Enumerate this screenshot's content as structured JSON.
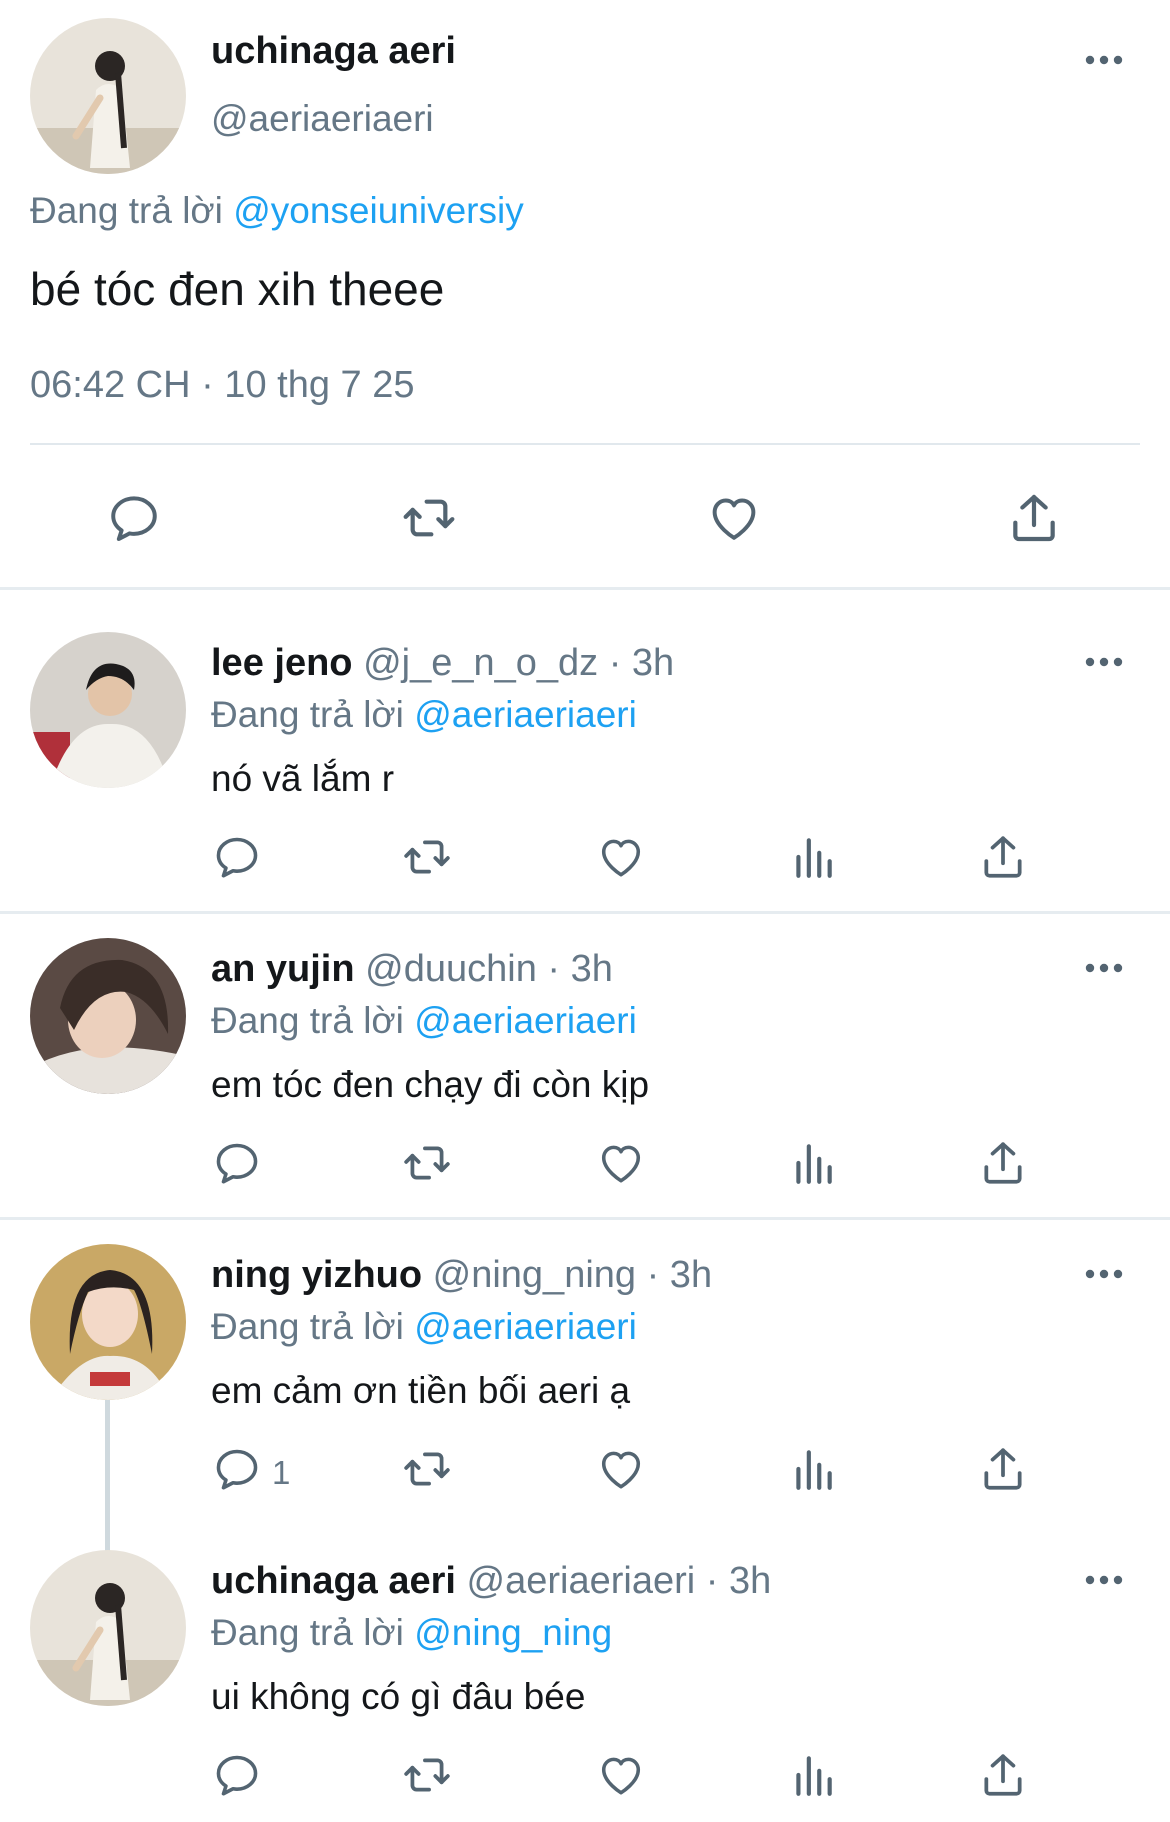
{
  "main_tweet": {
    "name": "uchinaga aeri",
    "handle": "@aeriaeriaeri",
    "replying_prefix": "Đang trả lời",
    "replying_to": "@yonseiuniversiy",
    "text": "bé tóc đen xih theee",
    "timestamp": "06:42 CH · 10 thg 7 25"
  },
  "replies": [
    {
      "name": "lee jeno",
      "meta": "@j_e_n_o_dz · 3h",
      "replying_prefix": "Đang trả lời",
      "replying_to": "@aeriaeriaeri",
      "text": "nó vã lắm r",
      "reply_count": ""
    },
    {
      "name": "an yujin",
      "meta": "@duuchin · 3h",
      "replying_prefix": "Đang trả lời",
      "replying_to": "@aeriaeriaeri",
      "text": "em tóc đen chạy đi còn kịp",
      "reply_count": ""
    },
    {
      "name": "ning yizhuo",
      "meta": "@ning_ning · 3h",
      "replying_prefix": "Đang trả lời",
      "replying_to": "@aeriaeriaeri",
      "text": "em cảm ơn tiền bối aeri ạ",
      "reply_count": "1"
    },
    {
      "name": "uchinaga aeri",
      "meta": "@aeriaeriaeri · 3h",
      "replying_prefix": "Đang trả lời",
      "replying_to": "@ning_ning",
      "text": "ui không có gì đâu bée",
      "reply_count": ""
    }
  ],
  "icons": {
    "reply": "reply-icon",
    "retweet": "retweet-icon",
    "like": "heart-icon",
    "views": "analytics-icon",
    "share": "share-icon",
    "more": "more-icon"
  },
  "colors": {
    "link": "#1da1f2",
    "secondary": "#657786",
    "icon": "#536471",
    "divider": "#e1e8ed"
  }
}
